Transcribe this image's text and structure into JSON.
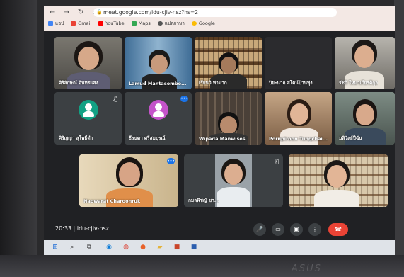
{
  "browser": {
    "url": "meet.google.com/idu-cjiv-nsz?hs=2",
    "bookmarks": [
      "แอป",
      "Gmail",
      "YouTube",
      "Maps",
      "แปลภาษา",
      "Google"
    ]
  },
  "participants": [
    {
      "name": "ศิริลักษณ์ อินทรแสง"
    },
    {
      "name": "Lamud Mantasombo..."
    },
    {
      "name": "เรียนวิ ท่ามาก"
    },
    {
      "name": "ปิยะนาถ สโตน์บ้านทุ่ง"
    },
    {
      "name": "รัชกิ ใหมาเกียรติกุล"
    },
    {
      "name": "ศิริญญา สุโพธิ์ตำ"
    },
    {
      "name": "ธีรนดา ศรีสมบุรณ์"
    },
    {
      "name": "Wipada Manwises"
    },
    {
      "name": "Pornpiroon Tungchai..."
    },
    {
      "name": "มลิวัลย์ปีฉัน"
    },
    {
      "name": "Naowarat Charoonruk"
    },
    {
      "name": "กมลพิชญ์ ขา..."
    },
    {
      "name": ""
    }
  ],
  "meeting": {
    "time": "20:33",
    "separator": "|",
    "code": "idu-cjiv-nsz"
  },
  "brand": "ASUS",
  "colors": {
    "accent": "#1a73e8",
    "end_call": "#ea4335",
    "background": "#202124"
  }
}
